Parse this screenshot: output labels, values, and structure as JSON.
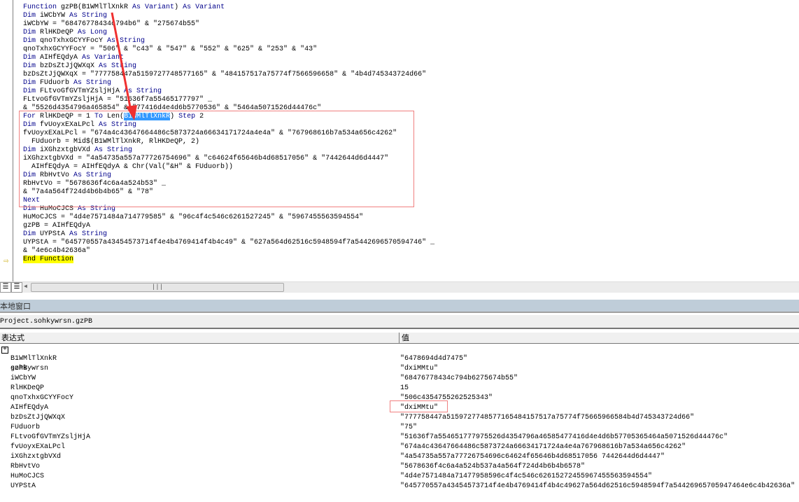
{
  "code": {
    "lines": [
      [
        [
          "kw",
          "Function "
        ],
        [
          "",
          "gzPB(B1WMlTlXnkR "
        ],
        [
          "kw",
          "As Variant"
        ],
        [
          "",
          ") "
        ],
        [
          "kw",
          "As Variant"
        ]
      ],
      [
        [
          "kw",
          "Dim "
        ],
        [
          "",
          "iWCbYW "
        ],
        [
          "kw",
          "As String"
        ]
      ],
      [
        [
          "",
          "iWCbYW = \"68476778434c794b6\" & \"275674b55\""
        ]
      ],
      [
        [
          "kw",
          "Dim "
        ],
        [
          "",
          "RlHKDeQP "
        ],
        [
          "kw",
          "As Long"
        ]
      ],
      [
        [
          "kw",
          "Dim "
        ],
        [
          "",
          "qnoTxhxGCYYFocY "
        ],
        [
          "kw",
          "As String"
        ]
      ],
      [
        [
          "",
          "qnoTxhxGCYYFocY = \"506\" & \"c43\" & \"547\" & \"552\" & \"625\" & \"253\" & \"43\""
        ]
      ],
      [
        [
          "kw",
          "Dim "
        ],
        [
          "",
          "AIHfEQdyA "
        ],
        [
          "kw",
          "As Variant"
        ]
      ],
      [
        [
          "kw",
          "Dim "
        ],
        [
          "",
          "bzDsZtJjQWXqX "
        ],
        [
          "kw",
          "As String"
        ]
      ],
      [
        [
          "",
          "bzDsZtJjQWXqX = \"777758447a5159727748577165\" & \"484157517a75774f7566596658\" & \"4b4d745343724d66\""
        ]
      ],
      [
        [
          "kw",
          "Dim "
        ],
        [
          "",
          "FUduorb "
        ],
        [
          "kw",
          "As String"
        ]
      ],
      [
        [
          "kw",
          "Dim "
        ],
        [
          "",
          "FLtvoGfGVTmYZsljHjA "
        ],
        [
          "kw",
          "As String"
        ]
      ],
      [
        [
          "",
          "FLtvoGfGVTmYZsljHjA = \"51636f7a55465177797\" _"
        ]
      ],
      [
        [
          "",
          "& \"5526d4354796a465854\" & \"77416d4e4d6b5770536\" & \"5464a5071526d44476c\""
        ]
      ],
      [
        [
          "kw",
          "For "
        ],
        [
          "",
          "RlHKDeQP = 1 "
        ],
        [
          "kw",
          "To "
        ],
        [
          "",
          "Len("
        ],
        [
          "sel",
          "B1WMlTlXnkR"
        ],
        [
          "",
          ") "
        ],
        [
          "kw",
          "Step "
        ],
        [
          "",
          "2"
        ]
      ],
      [
        [
          "kw",
          "Dim "
        ],
        [
          "",
          "fvUoyxEXaLPcl "
        ],
        [
          "kw",
          "As String"
        ]
      ],
      [
        [
          "",
          "fvUoyxEXaLPcl = \"674a4c43647664486c5873724a66634171724a4e4a\" & \"767968616b7a534a656c4262\""
        ]
      ],
      [
        [
          "",
          "  FUduorb = Mid$(B1WMlTlXnkR, RlHKDeQP, 2)"
        ]
      ],
      [
        [
          "kw",
          "Dim "
        ],
        [
          "",
          "iXGhzxtgbVXd "
        ],
        [
          "kw",
          "As String"
        ]
      ],
      [
        [
          "",
          "iXGhzxtgbVXd = \"4a54735a557a77726754696\" & \"c64624f65646b4d68517056\" & \"7442644d6d4447\""
        ]
      ],
      [
        [
          "",
          "  AIHfEQdyA = AIHfEQdyA & Chr(Val(\"&H\" & FUduorb))"
        ]
      ],
      [
        [
          "kw",
          "Dim "
        ],
        [
          "",
          "RbHvtVo "
        ],
        [
          "kw",
          "As String"
        ]
      ],
      [
        [
          "",
          "RbHvtVo = \"5678636f4c6a4a524b53\" _"
        ]
      ],
      [
        [
          "",
          "& \"7a4a564f724d4b6b4b65\" & \"78\""
        ]
      ],
      [
        [
          "kw",
          "Next"
        ]
      ],
      [
        [
          "kw",
          "Dim "
        ],
        [
          "",
          "HuMoCJCS "
        ],
        [
          "kw",
          "As String"
        ]
      ],
      [
        [
          "",
          "HuMoCJCS = \"4d4e7571484a714779585\" & \"96c4f4c546c6261527245\" & \"5967455563594554\""
        ]
      ],
      [
        [
          "",
          "gzPB = AIHfEQdyA"
        ]
      ],
      [
        [
          "kw",
          "Dim "
        ],
        [
          "",
          "UYPStA "
        ],
        [
          "kw",
          "As String"
        ]
      ],
      [
        [
          "",
          "UYPStA = \"645770557a43454573714f4e4b4769414f4b4c49\" & \"627a564d62516c5948594f7a5442696570594746\" _"
        ]
      ],
      [
        [
          "",
          "& \"4e6c4b42636a\""
        ]
      ],
      [
        [
          "hl",
          "End Function"
        ]
      ]
    ]
  },
  "locals": {
    "title": "本地窗口",
    "context": "Project.sohkywrsn.gzPB",
    "col_expression": "表达式",
    "col_value": "值",
    "module": "sohkywrsn",
    "rows": [
      {
        "name": "B1WMlTlXnkR",
        "value": "\"6478694d4d7475\""
      },
      {
        "name": "gzPB",
        "value": "\"dxiMMtu\""
      },
      {
        "name": "iWCbYW",
        "value": "\"68476778434c794b6275674b55\""
      },
      {
        "name": "RlHKDeQP",
        "value": "15"
      },
      {
        "name": "qnoTxhxGCYYFocY",
        "value": "\"506c4354755262525343\""
      },
      {
        "name": "AIHfEQdyA",
        "value": "\"dxiMMtu\""
      },
      {
        "name": "bzDsZtJjQWXqX",
        "value": "\"777758447a5159727748577165484157517a75774f75665966584b4d745343724d66\""
      },
      {
        "name": "FUduorb",
        "value": "\"75\""
      },
      {
        "name": "FLtvoGfGVTmYZsljHjA",
        "value": "\"51636f7a554651777975526d4354796a46585477416d4e4d6b57705365464a5071526d44476c\""
      },
      {
        "name": "fvUoyxEXaLPcl",
        "value": "\"674a4c43647664486c5873724a66634171724a4e4a767968616b7a534a656c4262\""
      },
      {
        "name": "iXGhzxtgbVXd",
        "value": "\"4a54735a557a77726754696c64624f65646b4d68517056 7442644d6d4447\""
      },
      {
        "name": "RbHvtVo",
        "value": "\"5678636f4c6a4a524b537a4a564f724d4b6b4b6578\""
      },
      {
        "name": "HuMoCJCS",
        "value": "\"4d4e7571484a71477958596c4f4c546c62615272455967455563594554\""
      },
      {
        "name": "UYPStA",
        "value": "\"645770557a43454573714f4e4b4769414f4b4c49627a564d62516c5948594f7a54426965705947464e6c4b42636a\""
      }
    ]
  },
  "colors": {
    "keyword": "#00008b",
    "highlight": "#ffff00",
    "annotation": "#f08080",
    "title_bar": "#bfcdd9"
  }
}
